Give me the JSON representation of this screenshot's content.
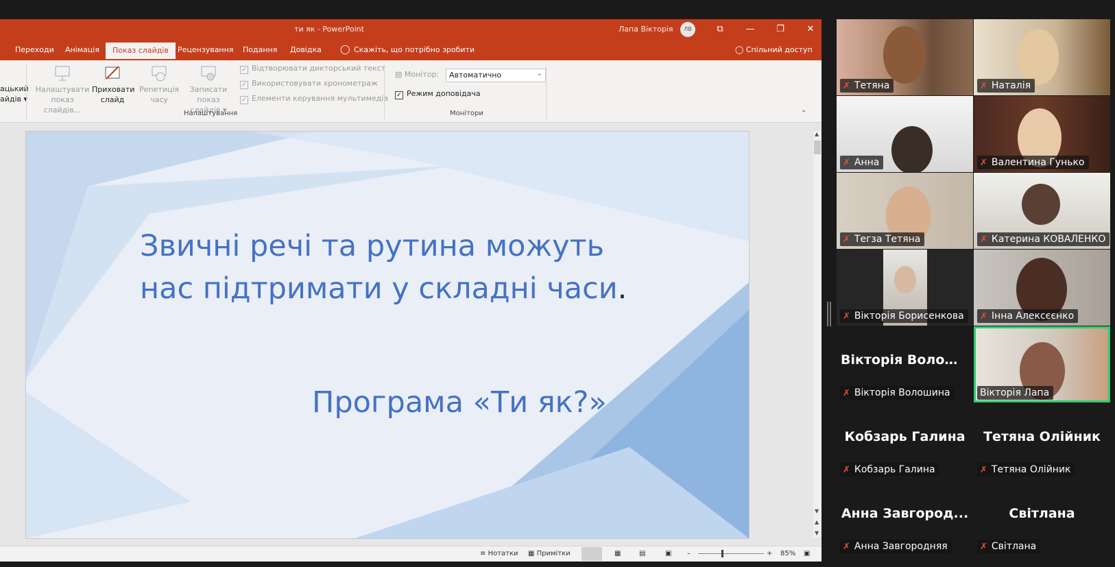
{
  "powerpoint": {
    "title": "ти як  -  PowerPoint",
    "user_name": "Лапа Вікторія",
    "user_initials": "ЛВ",
    "window_buttons": [
      "⧉",
      "—",
      "❐",
      "✕"
    ],
    "tabs": [
      {
        "label": "Переходи",
        "active": false
      },
      {
        "label": "Анімація",
        "active": false
      },
      {
        "label": "Показ слайдів",
        "active": true
      },
      {
        "label": "Рецензування",
        "active": false
      },
      {
        "label": "Подання",
        "active": false
      },
      {
        "label": "Довідка",
        "active": false
      }
    ],
    "tell_me": "Скажіть, що потрібно зробити",
    "share": "Спільний доступ",
    "ribbon": {
      "partial_button": [
        "ацький",
        "айдів ▾"
      ],
      "setup_show": [
        "Налаштувати",
        "показ слайдів..."
      ],
      "hide_slide": [
        "Приховати",
        "слайд"
      ],
      "rehearse": [
        "Репетиція",
        "часу"
      ],
      "record": [
        "Записати показ",
        "слайдів ▾"
      ],
      "checkboxes": [
        {
          "label": "Відтворювати дикторський текст",
          "checked": true
        },
        {
          "label": "Використовувати хронометраж",
          "checked": true
        },
        {
          "label": "Елементи керування мультимедіа",
          "checked": true
        }
      ],
      "group_setup": "Налаштування",
      "monitor_label": "Монітор:",
      "monitor_value": "Автоматично",
      "presenter_view": {
        "label": "Режим доповідача",
        "checked": true
      },
      "group_monitors": "Монітори"
    },
    "slide": {
      "line1": "Звичні речі та рутина можуть",
      "line2": "нас підтримати у складні  часи",
      "period": ".",
      "line3": "Програма  «Ти  як?»"
    },
    "status": {
      "notes": "Нотатки",
      "comments": "Примітки",
      "zoom": "85%"
    }
  },
  "zoom_gallery": {
    "participants": [
      {
        "label": "Тетяна",
        "big": "",
        "video": true
      },
      {
        "label": "Наталія",
        "big": "",
        "video": true
      },
      {
        "label": "Анна",
        "big": "",
        "video": true
      },
      {
        "label": "Валентина Гунько",
        "big": "",
        "video": true
      },
      {
        "label": "Тегза Тетяна",
        "big": "",
        "video": true
      },
      {
        "label": "Катерина КОВАЛЕНКО",
        "big": "",
        "video": true
      },
      {
        "label": "Вікторія Борисенкова",
        "big": "",
        "video": true
      },
      {
        "label": "Інна Алексєєнко",
        "big": "",
        "video": true
      },
      {
        "label": "Вікторія Волошина",
        "big": "Вікторія Волош...",
        "video": false
      },
      {
        "label": "Вікторія Лапа",
        "big": "",
        "video": true,
        "active_speaker": true
      },
      {
        "label": "Кобзарь Галина",
        "big": "Кобзарь Галина",
        "video": false
      },
      {
        "label": "Тетяна Олійник",
        "big": "Тетяна Олійник",
        "video": false
      },
      {
        "label": "Анна Завгородняя",
        "big": "Анна Завгород...",
        "video": false
      },
      {
        "label": "Світлана",
        "big": "Світлана",
        "video": false
      }
    ],
    "active_speaker_color": "#2ecc71",
    "mic_muted_color": "#e74c3c"
  }
}
